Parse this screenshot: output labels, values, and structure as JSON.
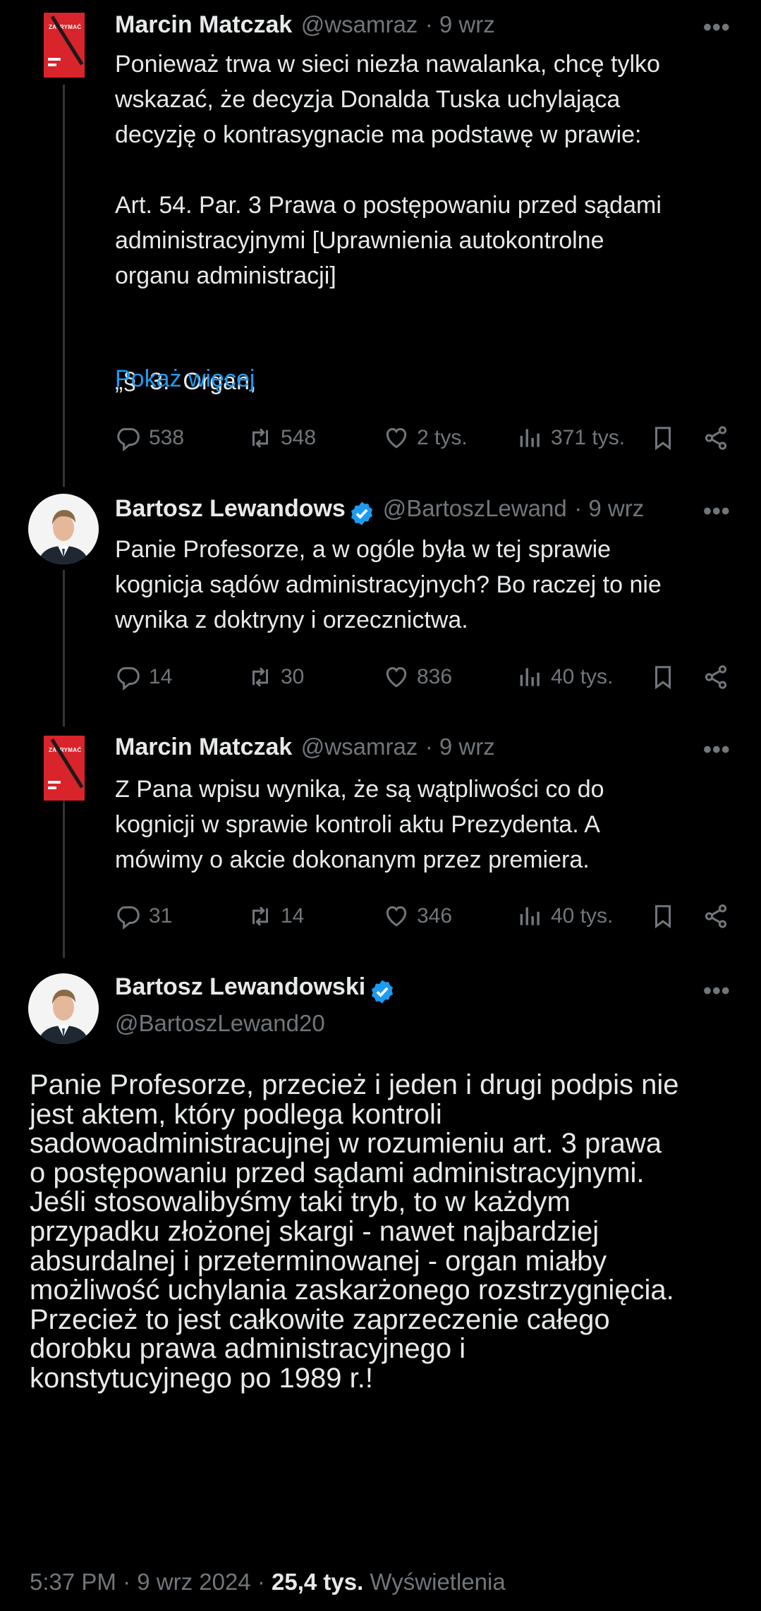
{
  "tweets": [
    {
      "author": "Marcin Matczak",
      "handle": "@wsamraz",
      "date": "· 9 wrz",
      "text": "Ponieważ trwa w sieci niezła nawalanka, chcę tylko\nwskazać, że decyzja Donalda Tuska uchylająca\ndecyzję o kontrasygnacie ma podstawę w prawie:\n\nArt. 54. Par. 3 Prawa o postępowaniu przed sądami\nadministracyjnymi [Uprawnienia autokontrolne\norganu administracji]\n\n\n„§  3.  Organ,",
      "show_more": "Pokaż więcej",
      "replies": "538",
      "reposts": "548",
      "likes": "2 tys.",
      "views": "371 tys.",
      "avatar_book_title": "ZATRYMAĆ"
    },
    {
      "author": "Bartosz Lewandows",
      "handle": "@BartoszLewand",
      "date": "· 9 wrz",
      "text": "Panie Profesorze, a w ogóle była w tej sprawie\nkognicja sądów administracyjnych? Bo raczej to nie\nwynika z doktryny i orzecznictwa.",
      "replies": "14",
      "reposts": "30",
      "likes": "836",
      "views": "40 tys."
    },
    {
      "author": "Marcin Matczak",
      "handle": "@wsamraz",
      "date": "· 9 wrz",
      "text": "Z Pana wpisu wynika, że są wątpliwości co do\nkognicji w sprawie kontroli aktu Prezydenta. A\nmówimy o akcie dokonanym przez premiera.",
      "replies": "31",
      "reposts": "14",
      "likes": "346",
      "views": "40 tys.",
      "avatar_book_title": "ZATRYMAĆ"
    }
  ],
  "main_tweet": {
    "author": "Bartosz Lewandowski",
    "handle": "@BartoszLewand20",
    "text": "Panie Profesorze, przecież i jeden i drugi podpis nie\njest aktem, który podlega kontroli\nsadowoadministracujnej w rozumieniu art. 3 prawa\no postępowaniu przed sądami administracyjnymi.\nJeśli stosowalibyśmy taki tryb, to w każdym\nprzypadku złożonej skargi - nawet najbardziej\nabsurdalnej i przeterminowanej - organ miałby\nmożliwość uchylania zaskarżonego rozstrzygnięcia.\nPrzecież to jest całkowite zaprzeczenie całego\ndorobku prawa administracyjnego i\nkonstytucyjnego po 1989 r.!",
    "time": "5:37 PM · 9 wrz 2024 · ",
    "views_count": "25,4 tys.",
    "views_label": " Wyświetlenia"
  },
  "more_glyph": "•••",
  "colors": {
    "background": "#000000",
    "text": "#e7e9ea",
    "muted": "#71767b",
    "link": "#1d9bf0",
    "verified": "#1d9bf0",
    "thread_line": "#333639"
  },
  "icons": [
    "reply-icon",
    "repost-icon",
    "like-icon",
    "views-icon",
    "bookmark-icon",
    "share-icon",
    "verified-icon",
    "more-icon"
  ]
}
